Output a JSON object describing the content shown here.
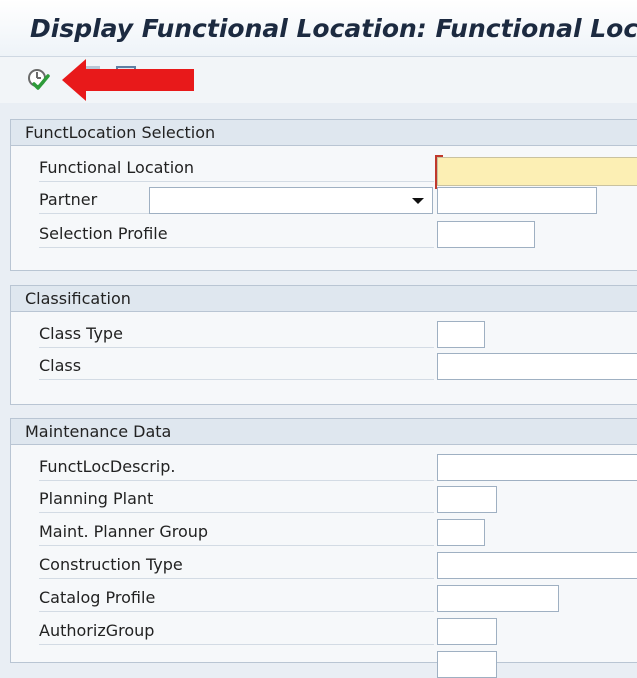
{
  "window": {
    "title": "Display Functional Location: Functional Location Selection"
  },
  "groups": {
    "selection": {
      "header": "FunctLocation Selection",
      "fields": {
        "functional_location": "Functional Location",
        "partner": "Partner",
        "selection_profile": "Selection Profile"
      }
    },
    "classification": {
      "header": "Classification",
      "fields": {
        "class_type": "Class Type",
        "class": "Class"
      }
    },
    "maintenance": {
      "header": "Maintenance Data",
      "fields": {
        "descrip": "FunctLocDescrip.",
        "planning_plant": "Planning Plant",
        "planner_group": "Maint. Planner Group",
        "construction_type": "Construction Type",
        "catalog_profile": "Catalog Profile",
        "authoriz_group": "AuthorizGroup"
      }
    }
  },
  "icons": {
    "execute": "execute-icon",
    "annotation": "red-arrow-icon"
  },
  "colors": {
    "required_field": "#fcefb4",
    "annotation_arrow": "#e8191a"
  }
}
